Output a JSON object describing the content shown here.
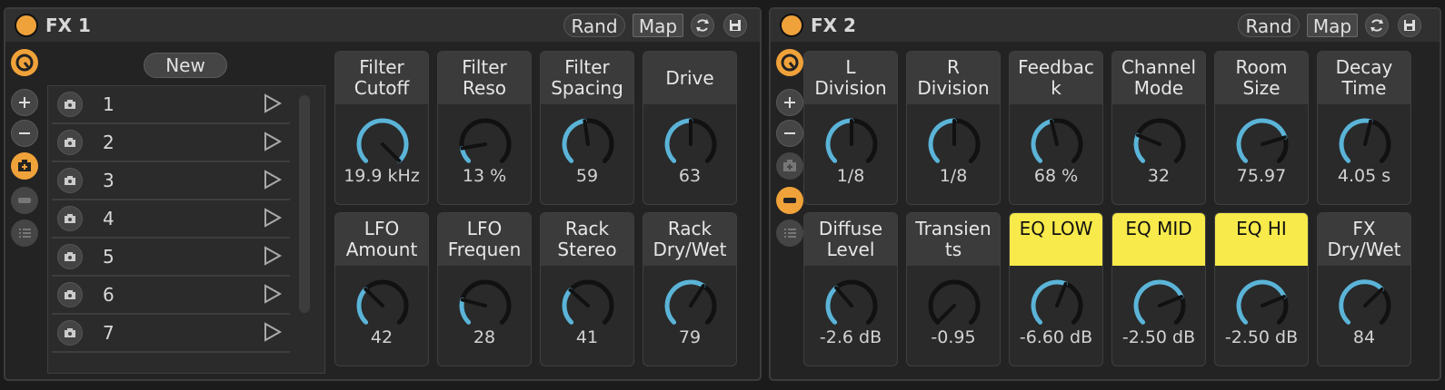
{
  "colors": {
    "accent": "#f0a23a",
    "knob_arc": "#5bb4d8",
    "highlight": "#f7ea4a"
  },
  "racks": [
    {
      "title": "FX 1",
      "rand_label": "Rand",
      "map_label": "Map",
      "new_label": "New",
      "variations": [
        "1",
        "2",
        "3",
        "4",
        "5",
        "6",
        "7"
      ],
      "macros": [
        {
          "label": "Filter\nCutoff",
          "value": "19.9 kHz",
          "level": 1.0
        },
        {
          "label": "Filter\nReso",
          "value": "13 %",
          "level": 0.13
        },
        {
          "label": "Filter\nSpacing",
          "value": "59",
          "level": 0.47
        },
        {
          "label": "Drive",
          "value": "63",
          "level": 0.5
        },
        {
          "label": "LFO\nAmount",
          "value": "42",
          "level": 0.33
        },
        {
          "label": "LFO\nFrequen",
          "value": "28",
          "level": 0.22
        },
        {
          "label": "Rack\nStereo",
          "value": "41",
          "level": 0.32
        },
        {
          "label": "Rack\nDry/Wet",
          "value": "79",
          "level": 0.62
        }
      ]
    },
    {
      "title": "FX 2",
      "rand_label": "Rand",
      "map_label": "Map",
      "macros": [
        {
          "label": "L\nDivision",
          "value": "1/8",
          "level": 0.5
        },
        {
          "label": "R\nDivision",
          "value": "1/8",
          "level": 0.5
        },
        {
          "label": "Feedbac\nk",
          "value": "68 %",
          "level": 0.45
        },
        {
          "label": "Channel\nMode",
          "value": "32",
          "level": 0.25
        },
        {
          "label": "Room\nSize",
          "value": "75.97",
          "level": 0.77
        },
        {
          "label": "Decay\nTime",
          "value": "4.05 s",
          "level": 0.55
        },
        {
          "label": "Diffuse\nLevel",
          "value": "-2.6 dB",
          "level": 0.35
        },
        {
          "label": "Transien\nts",
          "value": "-0.95",
          "level": 0.0
        },
        {
          "label": "EQ LOW",
          "value": "-6.60 dB",
          "level": 0.58,
          "highlight": true
        },
        {
          "label": "EQ MID",
          "value": "-2.50 dB",
          "level": 0.75,
          "highlight": true
        },
        {
          "label": "EQ HI",
          "value": "-2.50 dB",
          "level": 0.75,
          "highlight": true
        },
        {
          "label": "FX\nDry/Wet",
          "value": "84",
          "level": 0.67
        }
      ]
    }
  ]
}
